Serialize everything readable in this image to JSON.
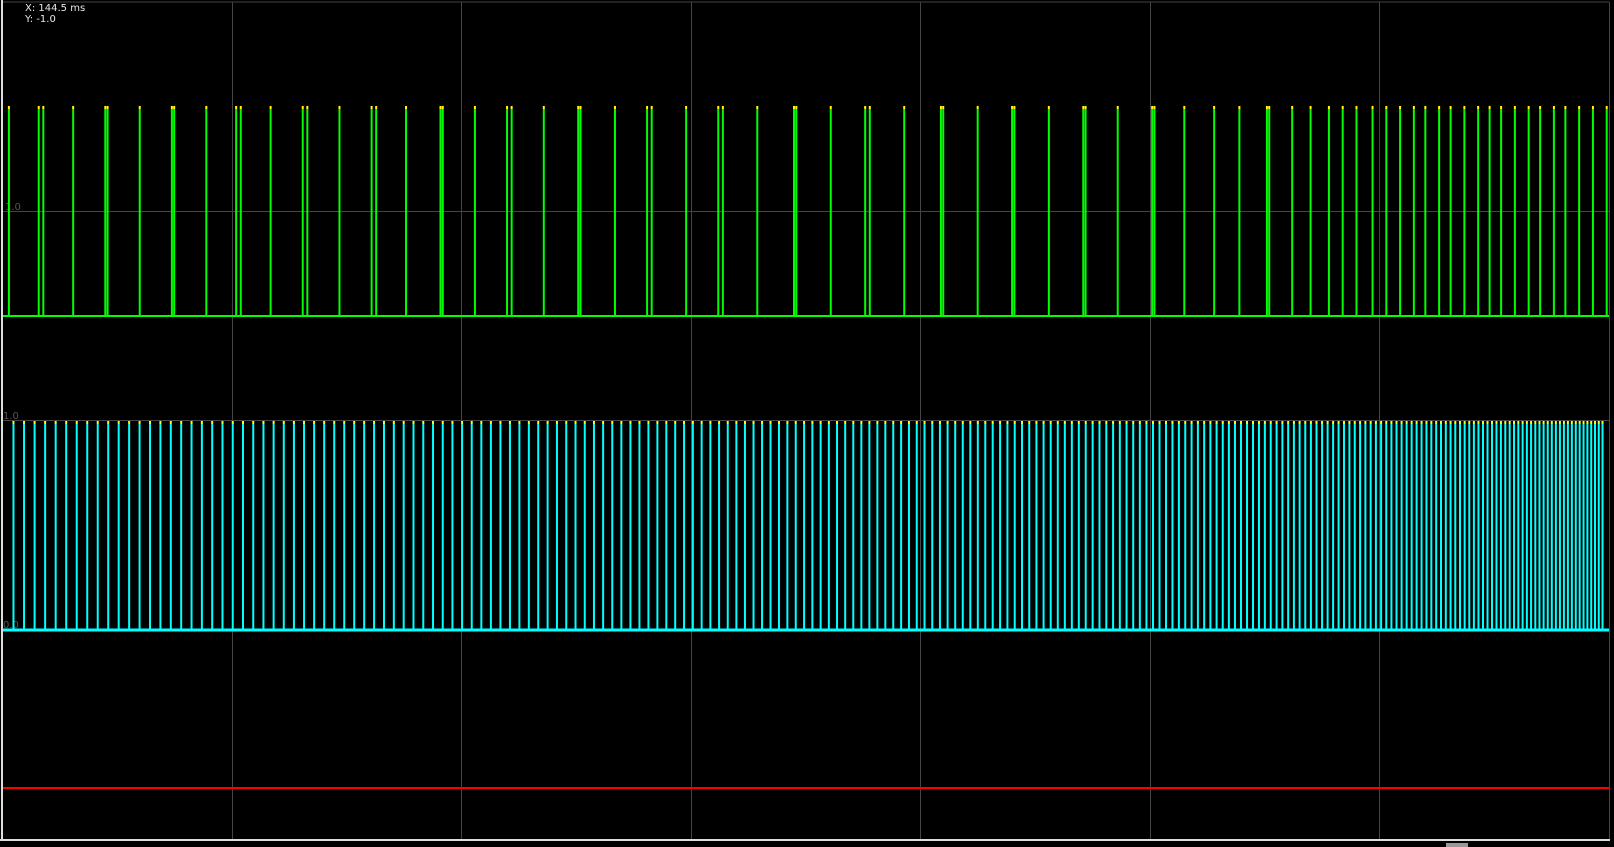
{
  "cursor_readout": {
    "x": "X: 144.5 ms",
    "y": "Y: -1.0"
  },
  "colors": {
    "background": "#000000",
    "grid": "#444444",
    "channel_1": "#00ff00",
    "channel_2": "#00ffff",
    "channel_3": "#ff0000",
    "pulse_tip": "#ffff00"
  },
  "chart_data": {
    "type": "line",
    "x_grid_divisions": 7,
    "grid": true,
    "channels": [
      {
        "id": "ch1",
        "y_tick_label": "1.0",
        "ylim": [
          0,
          2
        ],
        "pulse_level": 2,
        "pulses_x_div": [
          0.03,
          0.16,
          0.18,
          0.31,
          0.45,
          0.46,
          0.6,
          0.74,
          0.75,
          0.89,
          1.02,
          1.04,
          1.17,
          1.31,
          1.33,
          1.47,
          1.61,
          1.63,
          1.76,
          1.91,
          1.92,
          2.06,
          2.2,
          2.22,
          2.36,
          2.51,
          2.52,
          2.67,
          2.81,
          2.83,
          2.98,
          3.12,
          3.14,
          3.29,
          3.45,
          3.46,
          3.61,
          3.76,
          3.78,
          3.93,
          4.09,
          4.1,
          4.25,
          4.4,
          4.41,
          4.56,
          4.71,
          4.72,
          4.86,
          5.01,
          5.02,
          5.15,
          5.28,
          5.39,
          5.51,
          5.52,
          5.62,
          5.7,
          5.78,
          5.84,
          5.9,
          5.97,
          6.03,
          6.09,
          6.15,
          6.2,
          6.26,
          6.31,
          6.37,
          6.43,
          6.48,
          6.53,
          6.59,
          6.65,
          6.7,
          6.76,
          6.81,
          6.87,
          6.93,
          6.99
        ]
      },
      {
        "id": "ch2",
        "y_tick_labels": [
          "1.0",
          "0.0"
        ],
        "ylim": [
          0,
          1
        ],
        "pulse_level": 1,
        "pulse_train": "dense, frequency increasing toward the right"
      },
      {
        "id": "ch3",
        "constant_level": 0
      }
    ]
  }
}
